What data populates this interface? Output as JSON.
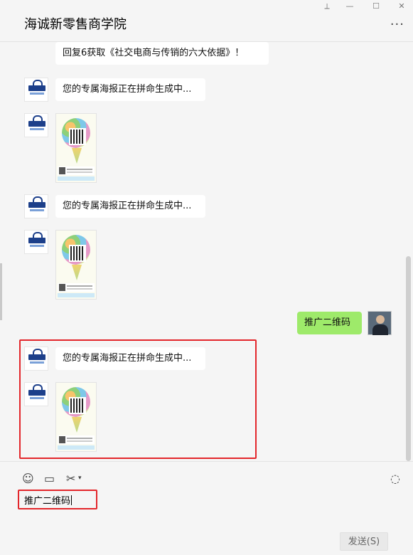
{
  "window": {
    "title": "海诚新零售商学院",
    "controls": {
      "pin": "⟂",
      "minimize": "—",
      "maximize": "☐",
      "close": "✕"
    },
    "more": "···"
  },
  "messages": [
    {
      "side": "left",
      "type": "text",
      "text": "回复6获取《社交电商与传销的六大依据》！"
    },
    {
      "side": "left",
      "type": "text",
      "text": "您的专属海报正在拼命生成中..."
    },
    {
      "side": "left",
      "type": "image",
      "alt": "poster-image"
    },
    {
      "side": "left",
      "type": "text",
      "text": "您的专属海报正在拼命生成中..."
    },
    {
      "side": "left",
      "type": "image",
      "alt": "poster-image"
    },
    {
      "side": "right",
      "type": "text",
      "text": "推广二维码"
    },
    {
      "side": "left",
      "type": "text",
      "text": "您的专属海报正在拼命生成中..."
    },
    {
      "side": "left",
      "type": "image",
      "alt": "poster-image"
    }
  ],
  "toolbar": {
    "emoji_icon": "☺",
    "folder_icon": "▭",
    "scissors_icon": "✂",
    "chat_icon": "◌"
  },
  "input": {
    "value": "推广二维码"
  },
  "send": {
    "label": "发送(S)"
  },
  "colors": {
    "self_bubble": "#9eea6a",
    "highlight": "#e3262b"
  }
}
